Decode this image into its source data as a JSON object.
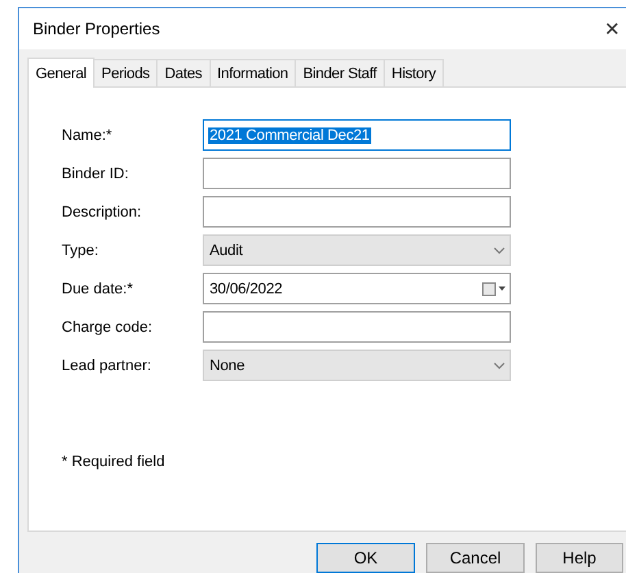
{
  "window": {
    "title": "Binder Properties",
    "close": "✕"
  },
  "tabs": [
    {
      "label": "General",
      "selected": true
    },
    {
      "label": "Periods",
      "selected": false
    },
    {
      "label": "Dates",
      "selected": false
    },
    {
      "label": "Information",
      "selected": false
    },
    {
      "label": "Binder Staff",
      "selected": false
    },
    {
      "label": "History",
      "selected": false
    }
  ],
  "fields": [
    {
      "label": "Name:*",
      "kind": "text",
      "value": "2021 Commercial Dec21",
      "focused": true,
      "value_highlighted": true
    },
    {
      "label": "Binder ID:",
      "kind": "text",
      "focused": false
    },
    {
      "label": "Description:",
      "kind": "text",
      "focused": false
    },
    {
      "label": "Type:",
      "kind": "select",
      "value": "Audit",
      "focused": false
    },
    {
      "label": "Due date:*",
      "kind": "date",
      "value": "30/06/2022",
      "focused": false
    },
    {
      "label": "Charge code:",
      "kind": "text",
      "focused": false
    },
    {
      "label": "Lead partner:",
      "kind": "select",
      "value": "None",
      "focused": false
    }
  ],
  "note": "* Required field",
  "buttons": [
    {
      "label": "OK",
      "default": true
    },
    {
      "label": "Cancel",
      "default": false
    },
    {
      "label": "Help",
      "default": false
    }
  ]
}
